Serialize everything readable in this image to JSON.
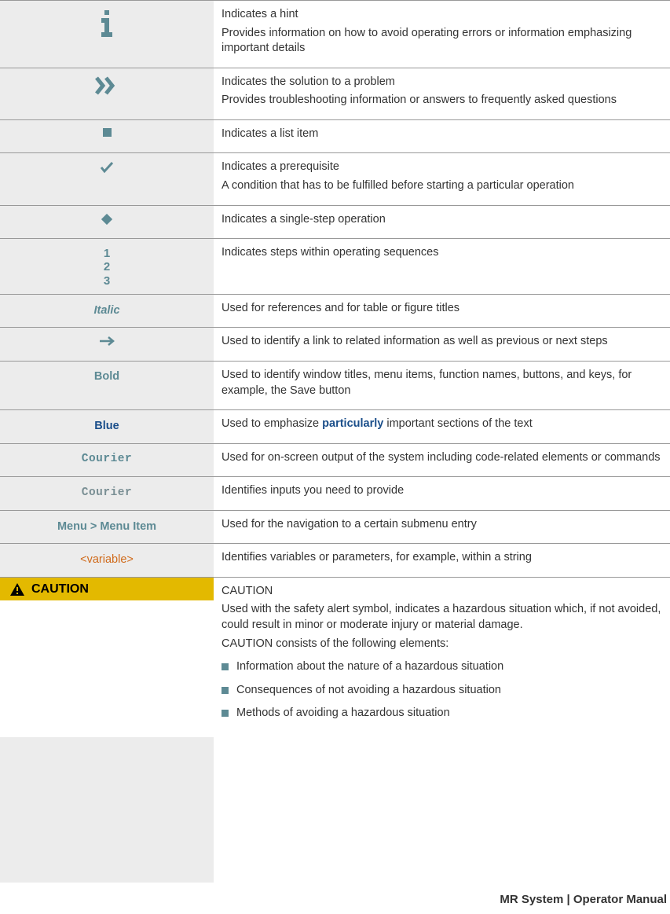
{
  "rows": {
    "hint": {
      "line1": "Indicates a hint",
      "line2": "Provides information on how to avoid operating errors or information emphasizing important details"
    },
    "solution": {
      "line1": "Indicates the solution to a problem",
      "line2": "Provides troubleshooting information or answers to frequently asked questions"
    },
    "listitem": {
      "line1": "Indicates a list item"
    },
    "prereq": {
      "line1": "Indicates a prerequisite",
      "line2": "A condition that has to be fulfilled before starting a particular operation"
    },
    "single": {
      "line1": "Indicates a single-step operation"
    },
    "steps": {
      "sym1": "1",
      "sym2": "2",
      "sym3": "3",
      "line1": "Indicates steps within operating sequences"
    },
    "italic": {
      "sym": "Italic",
      "line1": "Used for references and for table or figure titles"
    },
    "arrow": {
      "line1": "Used to identify a link to related information as well as previous or next steps"
    },
    "bold": {
      "sym": "Bold",
      "line1": "Used to identify window titles, menu items, function names, buttons, and keys, for example, the Save button"
    },
    "blue": {
      "sym": "Blue",
      "pre": "Used to emphasize ",
      "emph": "particularly",
      "post": " important sections of the text"
    },
    "courier": {
      "sym": "Courier",
      "line1": "Used for on-screen output of the system including code-related elements or commands"
    },
    "courier_b": {
      "sym": "Courier",
      "line1": "Identifies inputs you need to provide"
    },
    "menu": {
      "sym": "Menu > Menu Item",
      "line1": "Used for the navigation to a certain submenu entry"
    },
    "variable": {
      "sym": "<variable>",
      "line1": "Identifies variables or parameters, for example, within a string"
    },
    "caution": {
      "sym": "CAUTION",
      "h": "CAUTION",
      "p1": "Used with the safety alert symbol, indicates a hazardous situation which, if not avoided, could result in minor or moderate injury or material damage.",
      "p2": "CAUTION consists of the following elements:",
      "b1": "Information about the nature of a hazardous situation",
      "b2": "Consequences of not avoiding a hazardous situation",
      "b3": "Methods of avoiding a hazardous situation"
    }
  },
  "footer": "MR System | Operator Manual"
}
